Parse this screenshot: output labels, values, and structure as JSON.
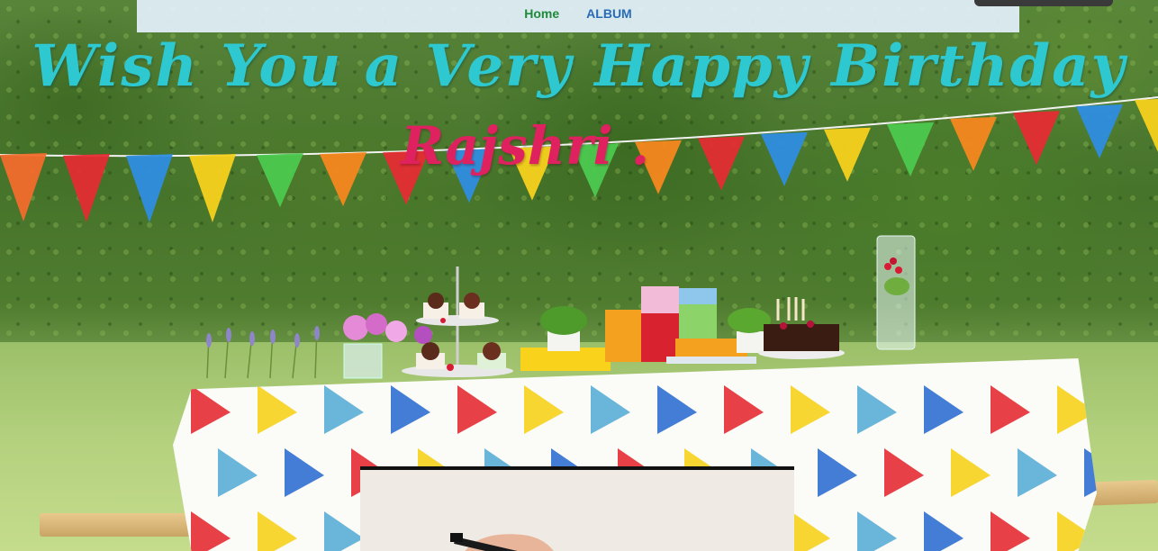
{
  "nav": {
    "items": [
      {
        "label": "Home",
        "color": "#1e8a3a",
        "active": true
      },
      {
        "label": "ALBUM",
        "color": "#2a6bb7",
        "active": false
      }
    ]
  },
  "headline": {
    "line1": "Wish You a Very Happy Birthday",
    "line2": "Rajshri .",
    "line1_color": "#2ec9d0",
    "line2_color": "#e0215f"
  },
  "bunting_colors": [
    "#f36b2c",
    "#e42c33",
    "#2f8de0",
    "#f7d11c",
    "#4cc94f",
    "#f7871f",
    "#e42c33",
    "#2f8de0",
    "#f7d11c",
    "#4cc94f",
    "#f7871f",
    "#e42c33",
    "#2f8de0",
    "#f7d11c",
    "#4cc94f",
    "#f7871f",
    "#e42c33",
    "#2f8de0",
    "#f7d11c"
  ],
  "tablecloth_colors": [
    "#e42c33",
    "#f7d11c",
    "#5aaed6",
    "#2f6fd0"
  ],
  "icons": {
    "video": "video-thumbnail",
    "menu": "menu-tab"
  }
}
